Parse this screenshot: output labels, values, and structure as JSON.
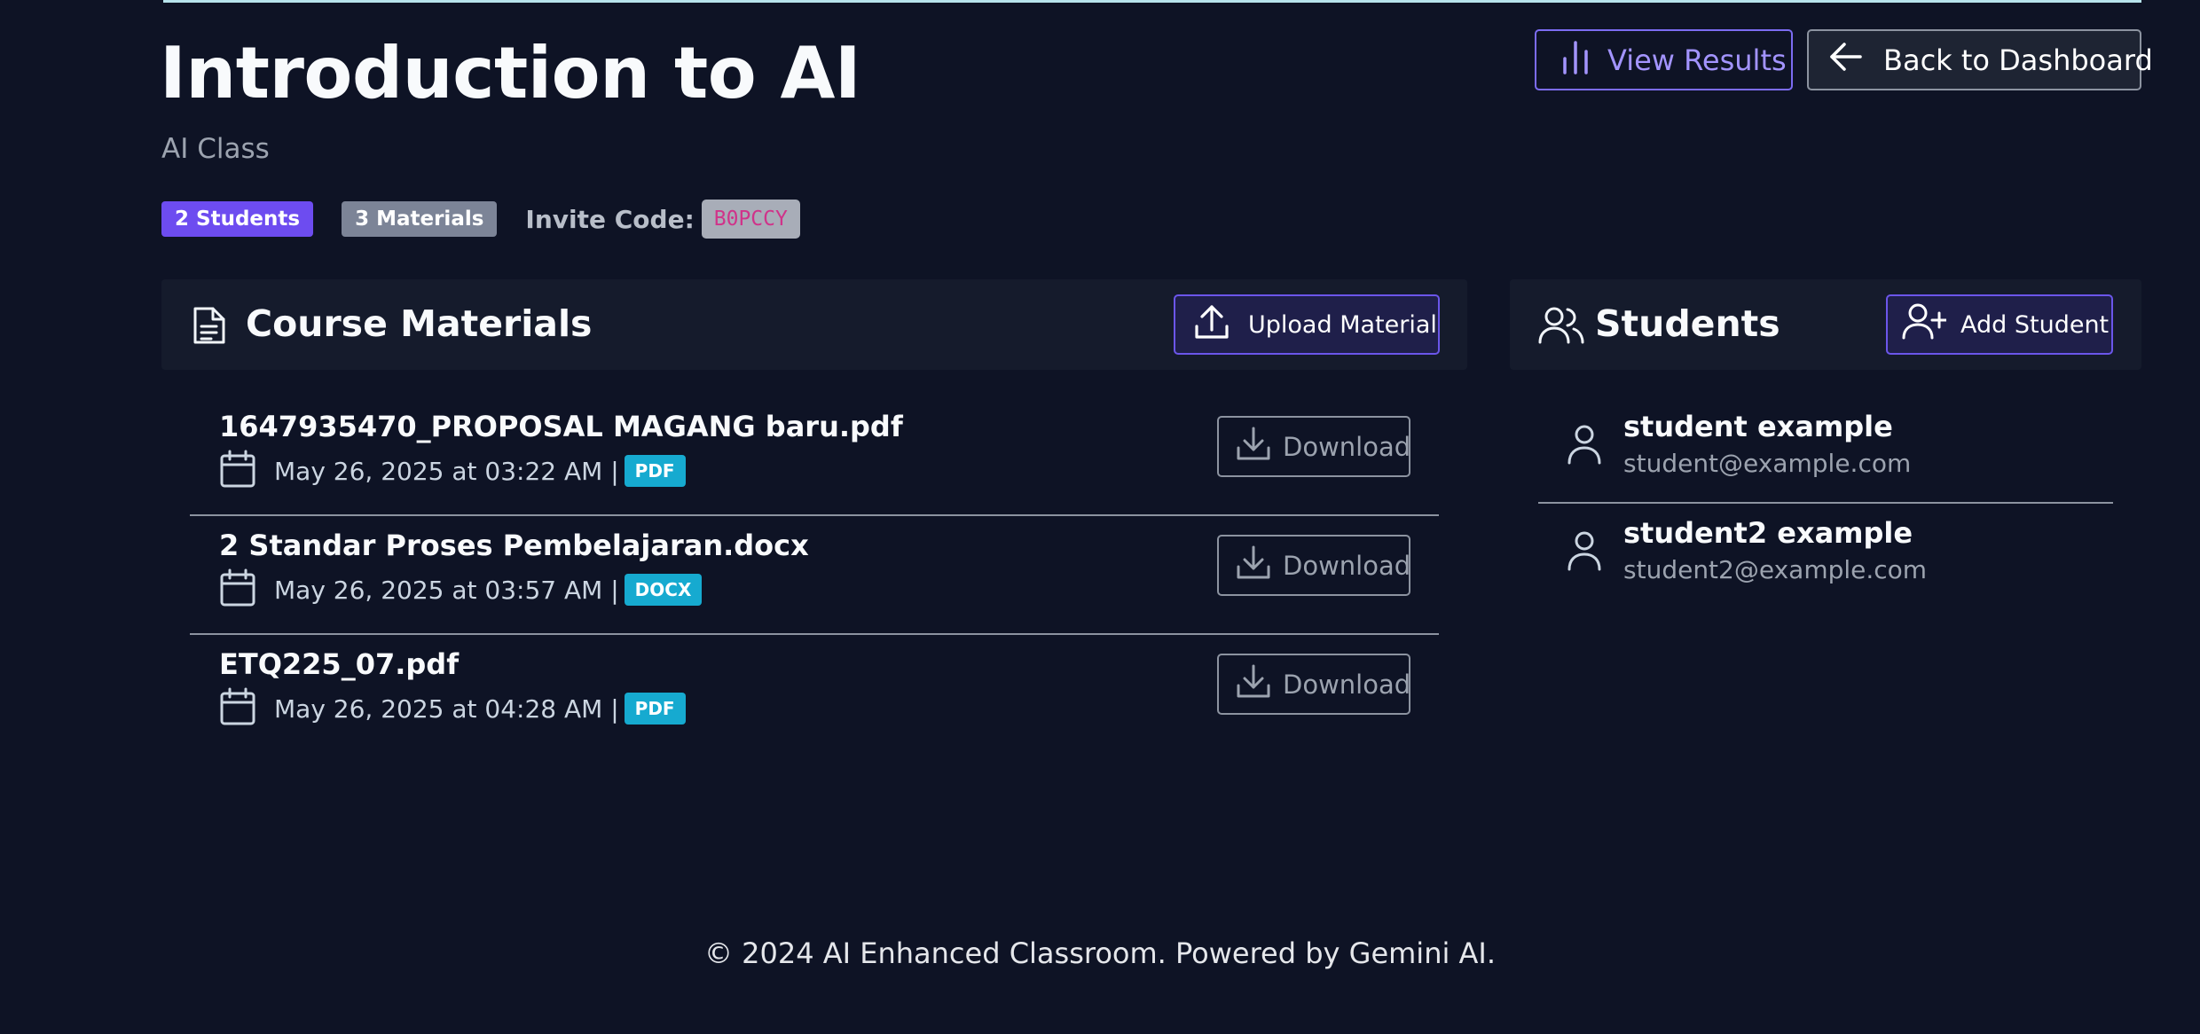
{
  "header": {
    "title": "Introduction to AI",
    "subtitle": "AI Class",
    "students_badge": "2 Students",
    "materials_badge": "3 Materials",
    "invite_label": "Invite Code:",
    "invite_code": "B0PCCY",
    "view_results_label": "View Results",
    "back_label": "Back to Dashboard"
  },
  "materials": {
    "title": "Course Materials",
    "upload_label": "Upload Material",
    "items": [
      {
        "name": "1647935470_PROPOSAL MAGANG baru.pdf",
        "date": "May 26, 2025 at 03:22 AM |",
        "type": "PDF",
        "download_label": "Download"
      },
      {
        "name": "2 Standar Proses Pembelajaran.docx",
        "date": "May 26, 2025 at 03:57 AM |",
        "type": "DOCX",
        "download_label": "Download"
      },
      {
        "name": "ETQ225_07.pdf",
        "date": "May 26, 2025 at 04:28 AM |",
        "type": "PDF",
        "download_label": "Download"
      }
    ]
  },
  "students": {
    "title": "Students",
    "add_label": "Add Student",
    "items": [
      {
        "name": "student example",
        "email": "student@example.com"
      },
      {
        "name": "student2 example",
        "email": "student2@example.com"
      }
    ]
  },
  "footer": {
    "text": "© 2024 AI Enhanced Classroom. Powered by Gemini AI."
  },
  "icons": {
    "view_results": "bar-chart-icon",
    "back": "arrow-left-icon",
    "materials": "document-icon",
    "upload": "upload-icon",
    "students": "users-icon",
    "add_student": "user-plus-icon",
    "date": "calendar-icon",
    "download": "download-icon",
    "student": "user-icon"
  },
  "colors": {
    "background": "#0e1325",
    "accent": "#6d4cf0",
    "file_badge": "#16aad0",
    "invite_code": "#d0338a"
  }
}
